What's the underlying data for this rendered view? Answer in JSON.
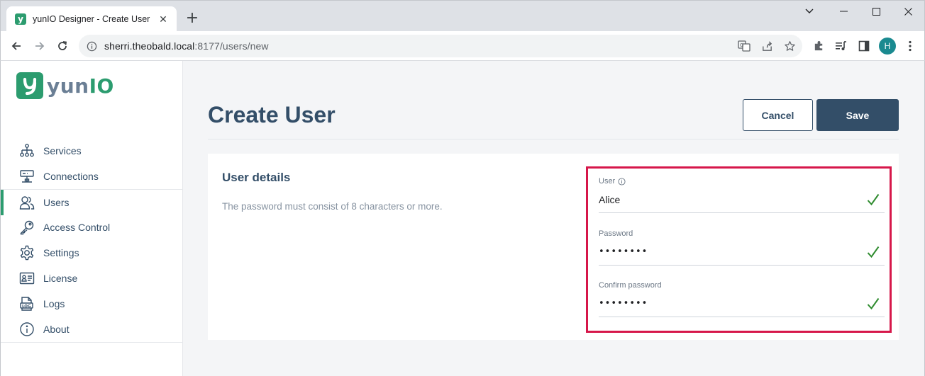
{
  "browser": {
    "tab_title": "yunIO Designer - Create User",
    "favicon_letter": "y",
    "new_tab": "+",
    "url_host": "sherri.theobald.local",
    "url_rest": ":8177/users/new",
    "profile_initial": "H"
  },
  "window_controls": {
    "minimize": "—",
    "maximize": "☐",
    "close": "✕",
    "dropdown": "⌄"
  },
  "logo": {
    "text_a": "yun",
    "text_b": "IO"
  },
  "sidebar": {
    "items": [
      {
        "label": "Services",
        "icon": "services-icon"
      },
      {
        "label": "Connections",
        "icon": "connections-icon"
      },
      {
        "label": "Users",
        "icon": "users-icon",
        "active": true
      },
      {
        "label": "Access Control",
        "icon": "key-icon"
      },
      {
        "label": "Settings",
        "icon": "gear-icon"
      },
      {
        "label": "License",
        "icon": "license-icon"
      },
      {
        "label": "Logs",
        "icon": "logs-icon"
      },
      {
        "label": "About",
        "icon": "info-icon"
      }
    ]
  },
  "page": {
    "title": "Create User",
    "cancel_label": "Cancel",
    "save_label": "Save"
  },
  "card": {
    "heading": "User details",
    "description": "The password must consist of 8 characters or more."
  },
  "form": {
    "user": {
      "label": "User",
      "value": "Alice",
      "valid": true
    },
    "password": {
      "label": "Password",
      "value": "••••••••",
      "valid": true
    },
    "confirm": {
      "label": "Confirm password",
      "value": "••••••••",
      "valid": true
    }
  },
  "colors": {
    "brand_green": "#2c9c6f",
    "navy": "#334e68",
    "highlight_red": "#d6174a",
    "check_green": "#2e8b2e"
  }
}
